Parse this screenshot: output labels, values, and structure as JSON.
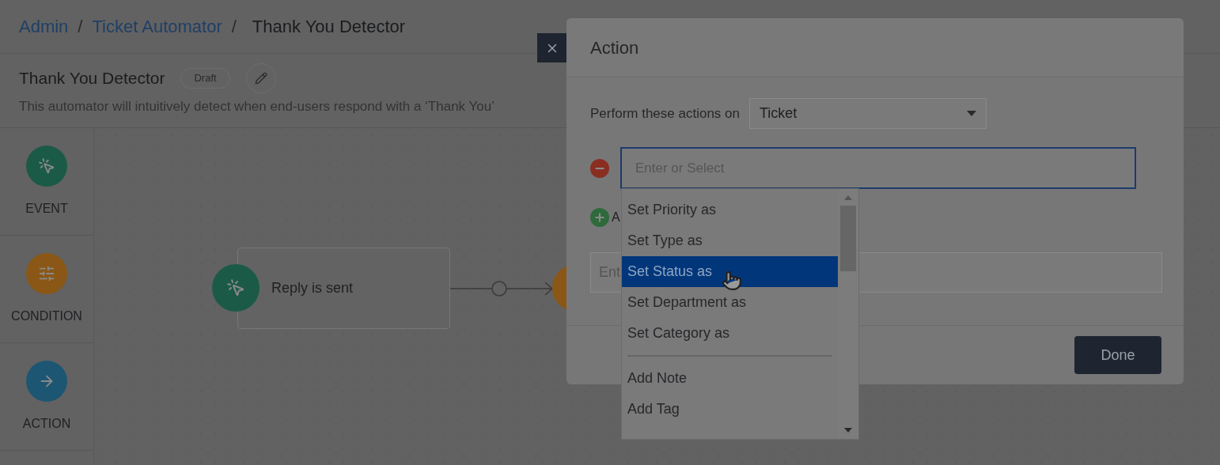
{
  "breadcrumb": [
    {
      "label": "Admin",
      "kind": "link"
    },
    {
      "label": "/",
      "kind": "separator"
    },
    {
      "label": "Ticket Automator",
      "kind": "link"
    },
    {
      "label": "/",
      "kind": "separator"
    },
    {
      "label": "Thank You Detector",
      "kind": "current"
    }
  ],
  "automator": {
    "title": "Thank You Detector",
    "status": "Draft",
    "description": "This automator will intuitively detect when end-users respond with a ‘Thank You’"
  },
  "sidebar": {
    "items": [
      {
        "label": "EVENT",
        "kind": "event"
      },
      {
        "label": "CONDITION",
        "kind": "condition"
      },
      {
        "label": "ACTION",
        "kind": "action"
      }
    ]
  },
  "canvas": {
    "nodes": [
      {
        "label": "Reply is sent",
        "kind": "event"
      }
    ]
  },
  "modal": {
    "title": "Action",
    "perform_label": "Perform these actions on",
    "target": "Ticket",
    "action_placeholder": "Enter or Select",
    "add_label": "A",
    "value_placeholder": "Ent",
    "done": "Done",
    "dropdown": [
      {
        "label": "Set Priority as",
        "selected": false,
        "divider_before": false
      },
      {
        "label": "Set Type as",
        "selected": false,
        "divider_before": false
      },
      {
        "label": "Set Status as",
        "selected": true,
        "divider_before": false
      },
      {
        "label": "Set Department as",
        "selected": false,
        "divider_before": false
      },
      {
        "label": "Set Category as",
        "selected": false,
        "divider_before": false
      },
      {
        "label": "Add Note",
        "selected": false,
        "divider_before": true
      },
      {
        "label": "Add Tag",
        "selected": false,
        "divider_before": false
      }
    ]
  }
}
